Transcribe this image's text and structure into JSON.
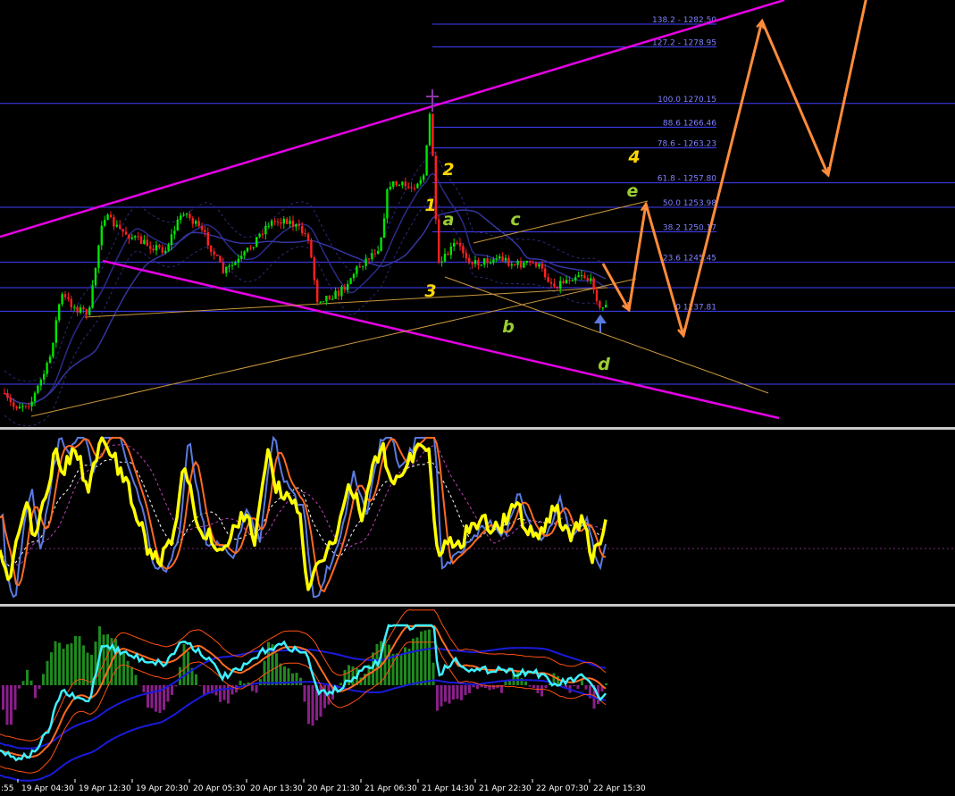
{
  "chart_data": {
    "type": "candlestick",
    "timeframe_labels": [
      "19 Apr 04:30",
      "19 Apr 12:30",
      "19 Apr 20:30",
      "20 Apr 05:30",
      "20 Apr 13:30",
      "20 Apr 21:30",
      "21 Apr 06:30",
      "21 Apr 14:30",
      "21 Apr 22:30",
      "22 Apr 07:30",
      "22 Apr 15:30"
    ],
    "left_edge_label": ":55",
    "price_range": [
      1232.0,
      1284.0
    ],
    "fibonacci_levels": [
      {
        "ratio": "138.2",
        "price": "1282.50",
        "label": "138.2 - 1282.50"
      },
      {
        "ratio": "127.2",
        "price": "1278.95",
        "label": "127.2 - 1278.95"
      },
      {
        "ratio": "100.0",
        "price": "1270.15",
        "label": "100.0 1270.15"
      },
      {
        "ratio": "88.6",
        "price": "1266.46",
        "label": "88.6 1266.46"
      },
      {
        "ratio": "78.6",
        "price": "1263.23",
        "label": "78.6 - 1263.23"
      },
      {
        "ratio": "61.8",
        "price": "1257.80",
        "label": "61.8 - 1257.80"
      },
      {
        "ratio": "50.0",
        "price": "1253.98",
        "label": "50.0 1253.98"
      },
      {
        "ratio": "38.2",
        "price": "1250.17",
        "label": "38.2 1250.17"
      },
      {
        "ratio": "23.6",
        "price": "1245.45",
        "label": "23.6 1245.45"
      },
      {
        "ratio": "0",
        "price": "1237.81",
        "label": "0 1237.81"
      }
    ],
    "wave_labels": [
      {
        "text": "1",
        "color": "#ffd700"
      },
      {
        "text": "2",
        "color": "#ffd700"
      },
      {
        "text": "3",
        "color": "#ffd700"
      },
      {
        "text": "4",
        "color": "#ffd700"
      },
      {
        "text": "a",
        "color": "#9acd32"
      },
      {
        "text": "b",
        "color": "#9acd32"
      },
      {
        "text": "c",
        "color": "#9acd32"
      },
      {
        "text": "d",
        "color": "#9acd32"
      },
      {
        "text": "e",
        "color": "#9acd32"
      }
    ],
    "projection_path_prices": [
      1245.2,
      1238.0,
      1254.5,
      1234.0,
      1283.0,
      1259.0,
      1290.0
    ],
    "colors": {
      "bull_candle": "#00e600",
      "bear_candle": "#ff2020",
      "channel": "#e600e6",
      "fib_line": "#4040ff",
      "fib_text": "#8080ff",
      "projection": "#ff8c3a",
      "oscillator_main": "#ffff00",
      "oscillator_fast": "#5a7ae0",
      "oscillator_slow": "#ff6a20",
      "hist_pos": "#1f8a1f",
      "hist_neg": "#8a1f8a",
      "cyan_line": "#3ff0ff"
    }
  }
}
